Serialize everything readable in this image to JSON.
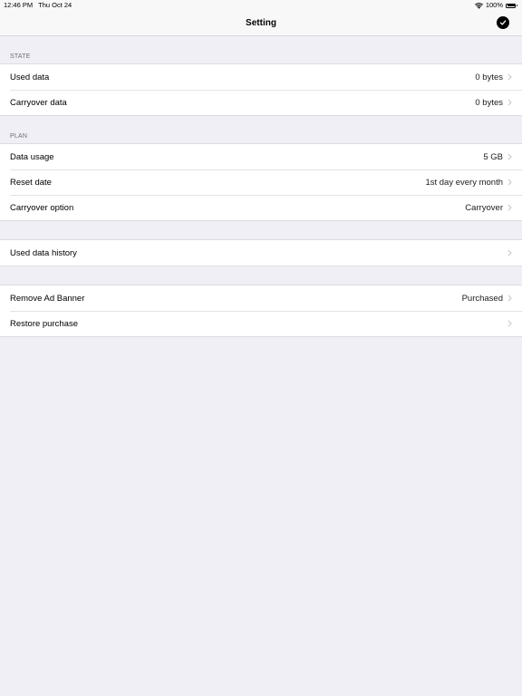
{
  "status_bar": {
    "time": "12:46 PM",
    "date": "Thu Oct 24",
    "battery": "100%",
    "battery_level": 1.0
  },
  "nav": {
    "title": "Setting",
    "done_icon": "checkmark-circle-icon"
  },
  "sections": {
    "state": {
      "header": "STATE",
      "rows": [
        {
          "label": "Used data",
          "value": "0 bytes"
        },
        {
          "label": "Carryover data",
          "value": "0 bytes"
        }
      ]
    },
    "plan": {
      "header": "PLAN",
      "rows": [
        {
          "label": "Data usage",
          "value": "5 GB"
        },
        {
          "label": "Reset date",
          "value": "1st day every month"
        },
        {
          "label": "Carryover option",
          "value": "Carryover"
        }
      ]
    },
    "history": {
      "rows": [
        {
          "label": "Used data history",
          "value": ""
        }
      ]
    },
    "purchase": {
      "rows": [
        {
          "label": "Remove Ad Banner",
          "value": "Purchased"
        },
        {
          "label": "Restore purchase",
          "value": ""
        }
      ]
    }
  },
  "colors": {
    "background": "#f0eff5",
    "cell": "#ffffff",
    "separator": "#dcdce0",
    "chevron": "#c4c4c7",
    "section_header": "#6d6d72"
  }
}
